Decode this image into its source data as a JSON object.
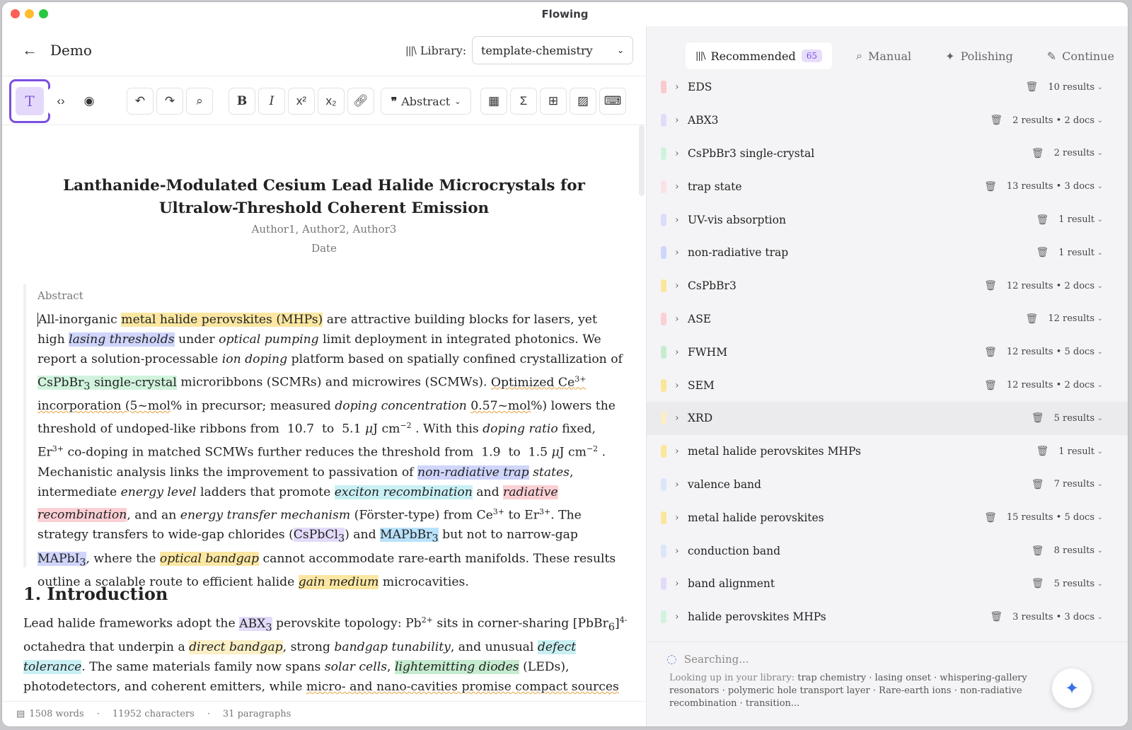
{
  "window": {
    "title": "Flowing"
  },
  "header": {
    "back_icon": "arrow-left-icon",
    "doc_title": "Demo",
    "library_label": "Library:",
    "library_value": "template-chemistry"
  },
  "toolbar": {
    "abstract_label": "Abstract",
    "superscript": "x²",
    "subscript": "x₂",
    "bold": "B",
    "italic": "I",
    "sigma": "Σ"
  },
  "paper": {
    "title": "Lanthanide-Modulated Cesium Lead Halide Microcrystals for Ultralow-Threshold Coherent Emission",
    "authors": "Author1, Author2, Author3",
    "date": "Date",
    "abstract_heading": "Abstract",
    "intro_heading": "1. Introduction"
  },
  "status": {
    "words": "1508 words",
    "characters": "11952 characters",
    "paragraphs": "31 paragraphs"
  },
  "tabs": [
    {
      "label": "Recommended",
      "count": "65"
    },
    {
      "label": "Manual"
    },
    {
      "label": "Polishing"
    },
    {
      "label": "Continue"
    }
  ],
  "keywords": [
    {
      "label": "EDS",
      "results": "10 results",
      "color": "#f9c9cd"
    },
    {
      "label": "ABX3",
      "results": "2 results • 2 docs",
      "color": "#e4dbfb"
    },
    {
      "label": "CsPbBr3 single-crystal",
      "results": "2 results",
      "color": "#d1f3dd"
    },
    {
      "label": "trap state",
      "results": "13 results • 3 docs",
      "color": "#fbe1e6"
    },
    {
      "label": "UV-vis absorption",
      "results": "1 result",
      "color": "#dcdcfb"
    },
    {
      "label": "non-radiative trap",
      "results": "1 result",
      "color": "#cfd5fb"
    },
    {
      "label": "CsPbBr3",
      "results": "12 results • 2 docs",
      "color": "#fbe69a"
    },
    {
      "label": "ASE",
      "results": "12 results",
      "color": "#fbd0d4"
    },
    {
      "label": "FWHM",
      "results": "12 results • 5 docs",
      "color": "#c6ecd0"
    },
    {
      "label": "SEM",
      "results": "12 results • 2 docs",
      "color": "#fbe69a"
    },
    {
      "label": "XRD",
      "results": "5 results",
      "color": "#fbedc6"
    },
    {
      "label": "metal halide perovskites MHPs",
      "results": "1 result",
      "color": "#fbe69a"
    },
    {
      "label": "valence band",
      "results": "7 results",
      "color": "#dbe6fb"
    },
    {
      "label": "metal halide perovskites",
      "results": "15 results • 5 docs",
      "color": "#fbe69a"
    },
    {
      "label": "conduction band",
      "results": "8 results",
      "color": "#dbe6fb"
    },
    {
      "label": "band alignment",
      "results": "5 results",
      "color": "#e4dbfb"
    },
    {
      "label": "halide perovskites MHPs",
      "results": "3 results • 3 docs",
      "color": "#d1f3dd"
    }
  ],
  "search": {
    "status": "Searching...",
    "prefix": "Looking up in your library:",
    "terms": "trap chemistry · lasing onset · whispering-gallery resonators · polymeric hole transport layer · Rare-earth ions · non-radiative recombination · transition..."
  }
}
